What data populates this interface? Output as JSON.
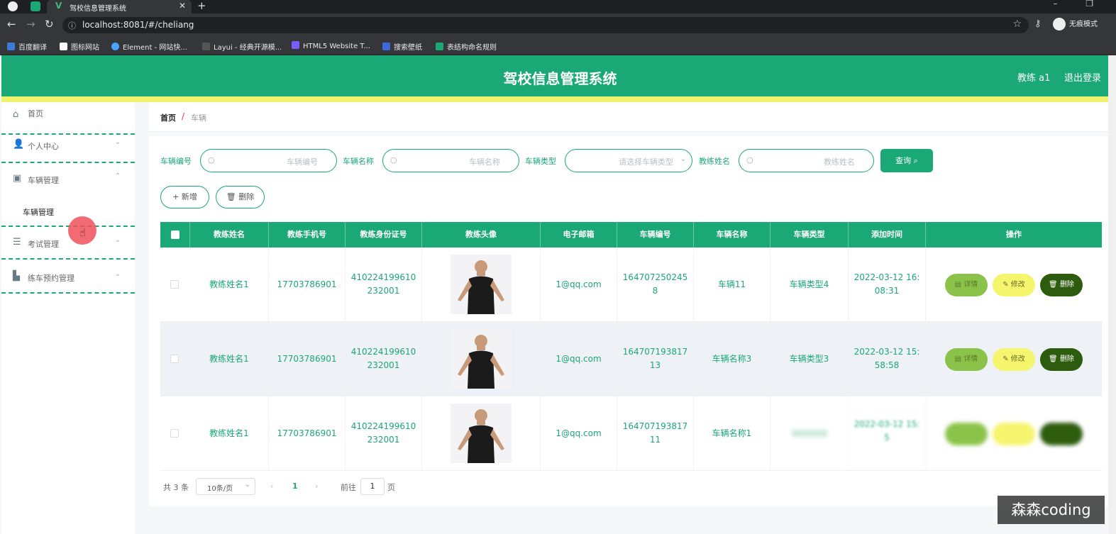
{
  "browser": {
    "tab_title": "驾校信息管理系统",
    "tab_close": "✕",
    "new_tab": "+",
    "url": "localhost:8081/#/cheliang",
    "incognito_label": "无痕模式",
    "bookmarks": [
      "百度翻译",
      "图标网站",
      "Element - 网站快...",
      "Layui - 经典开源模...",
      "HTML5 Website T...",
      "搜索壁纸",
      "表结构命名规则"
    ]
  },
  "header": {
    "title": "驾校信息管理系统",
    "user": "教练 a1",
    "logout": "退出登录"
  },
  "sidebar": {
    "items": [
      {
        "label": "首页",
        "icon": "home-icon"
      },
      {
        "label": "个人中心",
        "icon": "user-icon"
      },
      {
        "label": "车辆管理",
        "icon": "clipboard-icon"
      },
      {
        "label": "考试管理",
        "icon": "sliders-icon"
      },
      {
        "label": "练车预约管理",
        "icon": "car-icon"
      }
    ],
    "sub_item": "车辆管理"
  },
  "breadcrumb": {
    "home": "首页",
    "sep": "/",
    "current": "车辆"
  },
  "filters": {
    "vehicle_no_label": "车辆编号",
    "vehicle_no_ph": "车辆编号",
    "vehicle_name_label": "车辆名称",
    "vehicle_name_ph": "车辆名称",
    "vehicle_type_label": "车辆类型",
    "vehicle_type_ph": "请选择车辆类型",
    "coach_name_label": "教练姓名",
    "coach_name_ph": "教练姓名",
    "search_btn": "查询"
  },
  "actions": {
    "add": "新增",
    "delete": "删除"
  },
  "table": {
    "columns": [
      "教练姓名",
      "教练手机号",
      "教练身份证号",
      "教练头像",
      "电子邮箱",
      "车辆编号",
      "车辆名称",
      "车辆类型",
      "添加时间",
      "操作"
    ],
    "rows": [
      {
        "name": "教练姓名1",
        "phone": "17703786901",
        "idcard": "410224199610232001",
        "email": "1@qq.com",
        "vno": "1647072502458",
        "vname": "车辆11",
        "vtype": "车辆类型4",
        "time": "2022-03-12 16:08:31"
      },
      {
        "name": "教练姓名1",
        "phone": "17703786901",
        "idcard": "410224199610232001",
        "email": "1@qq.com",
        "vno": "16470719381713",
        "vname": "车辆名称3",
        "vtype": "车辆类型3",
        "time": "2022-03-12 15:58:58"
      },
      {
        "name": "教练姓名1",
        "phone": "17703786901",
        "idcard": "410224199610232001",
        "email": "1@qq.com",
        "vno": "16470719381711",
        "vname": "车辆名称1",
        "vtype": "",
        "time": "2022-03-12 15:5"
      }
    ],
    "btn_detail": "详情",
    "btn_edit": "修改",
    "btn_delete": "删除"
  },
  "pager": {
    "total": "共 3 条",
    "size": "10条/页",
    "page": "1",
    "goto": "前往",
    "goto_val": "1",
    "page_unit": "页"
  },
  "watermark": "森森coding",
  "colors": {
    "brand": "#1aa876",
    "stripe": "#f1f26c"
  }
}
